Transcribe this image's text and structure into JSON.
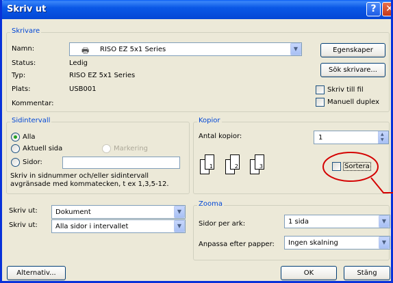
{
  "window": {
    "title": "Skriv ut"
  },
  "printer": {
    "legend": "Skrivare",
    "name_label": "Namn:",
    "name_value": "RISO EZ 5x1 Series",
    "status_label": "Status:",
    "status_value": "Ledig",
    "type_label": "Typ:",
    "type_value": "RISO EZ 5x1 Series",
    "location_label": "Plats:",
    "location_value": "USB001",
    "comment_label": "Kommentar:",
    "properties_button": "Egenskaper",
    "find_printer_button": "Sök skrivare...",
    "print_to_file": "Skriv till fil",
    "manual_duplex": "Manuell duplex"
  },
  "page_range": {
    "legend": "Sidintervall",
    "all": "Alla",
    "current": "Aktuell sida",
    "selection": "Markering",
    "pages": "Sidor:",
    "hint": "Skriv in sidnummer och/eller sidintervall avgränsade med kommatecken, t ex 1,3,5-12."
  },
  "copies": {
    "legend": "Kopior",
    "count_label": "Antal kopior:",
    "count_value": "1",
    "collate": "Sortera",
    "page_numbers": [
      "1",
      "2",
      "3"
    ]
  },
  "print_what": {
    "label": "Skriv ut:",
    "value": "Dokument",
    "print_label": "Skriv ut:",
    "print_value": "Alla sidor i intervallet"
  },
  "zoom": {
    "legend": "Zooma",
    "pages_per_sheet_label": "Sidor per ark:",
    "pages_per_sheet_value": "1 sida",
    "scale_label": "Anpassa efter papper:",
    "scale_value": "Ingen skalning"
  },
  "buttons": {
    "options": "Alternativ...",
    "ok": "OK",
    "close": "Stäng"
  },
  "colors": {
    "title_bar": "#0a58e6",
    "highlight": "#d40000",
    "legend": "#0046d5"
  }
}
